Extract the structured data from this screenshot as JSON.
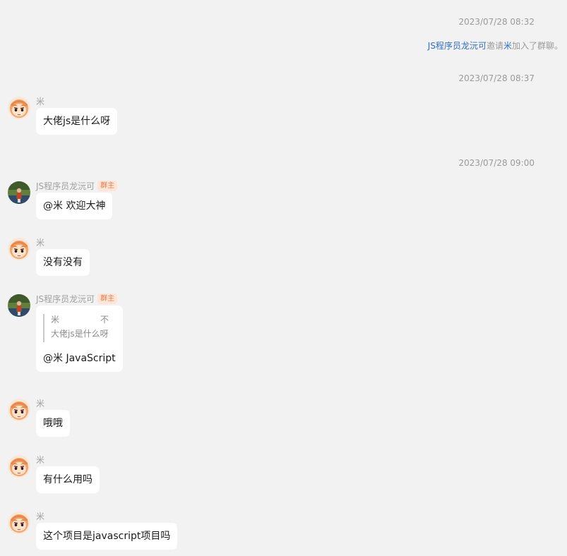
{
  "timestamps": [
    "2023/07/28 08:32",
    "2023/07/28 08:37",
    "2023/07/28 09:00"
  ],
  "system_note": {
    "inviter": "JS程序员龙沅可",
    "text1": "邀请",
    "invitee": "米",
    "text2": "加入了群聊。"
  },
  "users": {
    "mi": {
      "name": "米",
      "avatar": "orange-haired-cartoon-girl-avatar"
    },
    "owner": {
      "name": "JS程序员龙沅可",
      "badge": "群主",
      "avatar": "landscape-photo-avatar"
    }
  },
  "messages": [
    {
      "sender": "米",
      "text": "大佬js是什么呀"
    },
    {
      "sender": "JS程序员龙沅可",
      "badge": "群主",
      "text": "@米 欢迎大神"
    },
    {
      "sender": "米",
      "text": "没有没有"
    },
    {
      "sender": "JS程序员龙沅可",
      "badge": "群主",
      "quote": {
        "author": "米",
        "marker": "不",
        "text": "大佬js是什么呀"
      },
      "text": "@米 JavaScript"
    },
    {
      "sender": "米",
      "text": "哦哦"
    },
    {
      "sender": "米",
      "text": "有什么用吗"
    },
    {
      "sender": "米",
      "text": "这个项目是javascript项目吗"
    }
  ],
  "colors": {
    "background": "#f2f2f2",
    "bubble": "#ffffff",
    "link": "#2f6fbf",
    "badge_text": "#f07a3e",
    "badge_bg": "#fde5d7"
  }
}
